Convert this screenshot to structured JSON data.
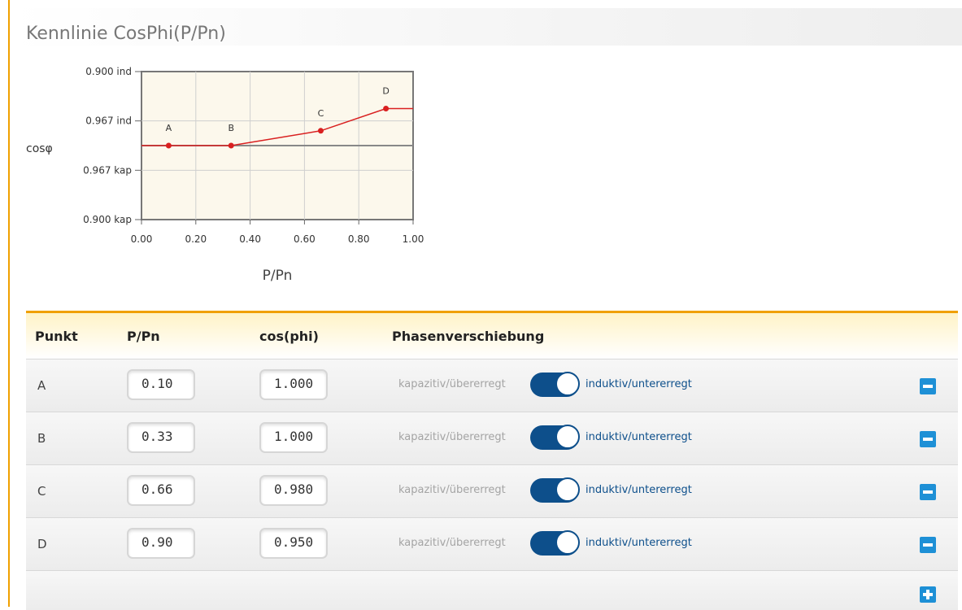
{
  "page": {
    "title": "Kennlinie CosPhi(P/Pn)"
  },
  "chart_data": {
    "type": "line",
    "title": "",
    "xlabel": "P/Pn",
    "ylabel": "cosφ",
    "xlim": [
      0,
      1
    ],
    "x_ticks": [
      "0.00",
      "0.20",
      "0.40",
      "0.60",
      "0.80",
      "1.00"
    ],
    "y_ticks": [
      "0.900 ind",
      "0.967 ind",
      "0.967 kap",
      "0.900 kap"
    ],
    "grid": true,
    "points": [
      {
        "label": "A",
        "x": 0.1,
        "y": 1.0
      },
      {
        "label": "B",
        "x": 0.33,
        "y": 1.0
      },
      {
        "label": "C",
        "x": 0.66,
        "y": 0.98
      },
      {
        "label": "D",
        "x": 0.9,
        "y": 0.95
      }
    ],
    "line_color": "#d92020"
  },
  "table": {
    "headers": {
      "punkt": "Punkt",
      "ppn": "P/Pn",
      "cosphi": "cos(phi)",
      "phase": "Phasenverschiebung"
    },
    "rows": [
      {
        "punkt": "A",
        "ppn": "0.10",
        "cosphi": "1.000",
        "kap_label": "kapazitiv/übererregt",
        "ind_label": "induktiv/untererregt",
        "inductive": true
      },
      {
        "punkt": "B",
        "ppn": "0.33",
        "cosphi": "1.000",
        "kap_label": "kapazitiv/übererregt",
        "ind_label": "induktiv/untererregt",
        "inductive": true
      },
      {
        "punkt": "C",
        "ppn": "0.66",
        "cosphi": "0.980",
        "kap_label": "kapazitiv/übererregt",
        "ind_label": "induktiv/untererregt",
        "inductive": true
      },
      {
        "punkt": "D",
        "ppn": "0.90",
        "cosphi": "0.950",
        "kap_label": "kapazitiv/übererregt",
        "ind_label": "induktiv/untererregt",
        "inductive": true
      }
    ]
  },
  "colors": {
    "accent": "#f0a000",
    "toggle": "#0d4f8b",
    "button": "#1e90d6",
    "curve": "#d92020"
  }
}
